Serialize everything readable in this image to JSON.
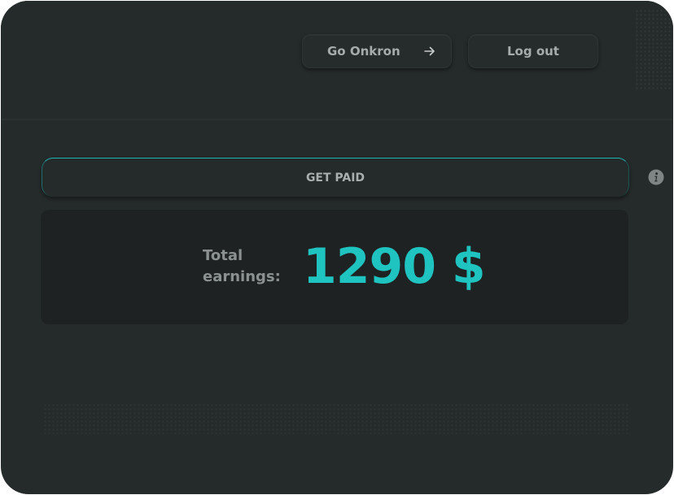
{
  "header": {
    "go_button_label": "Go Onkron",
    "go_button_icon": "arrow-right-icon",
    "logout_button_label": "Log out"
  },
  "payout": {
    "get_paid_label": "GET PAID",
    "info_icon": "info-icon"
  },
  "earnings": {
    "label": "Total earnings:",
    "value": "1290 $"
  },
  "colors": {
    "background": "#252a2a",
    "panel": "#1e2222",
    "accent": "#1fc4c1",
    "button_text": "#a6abab"
  }
}
